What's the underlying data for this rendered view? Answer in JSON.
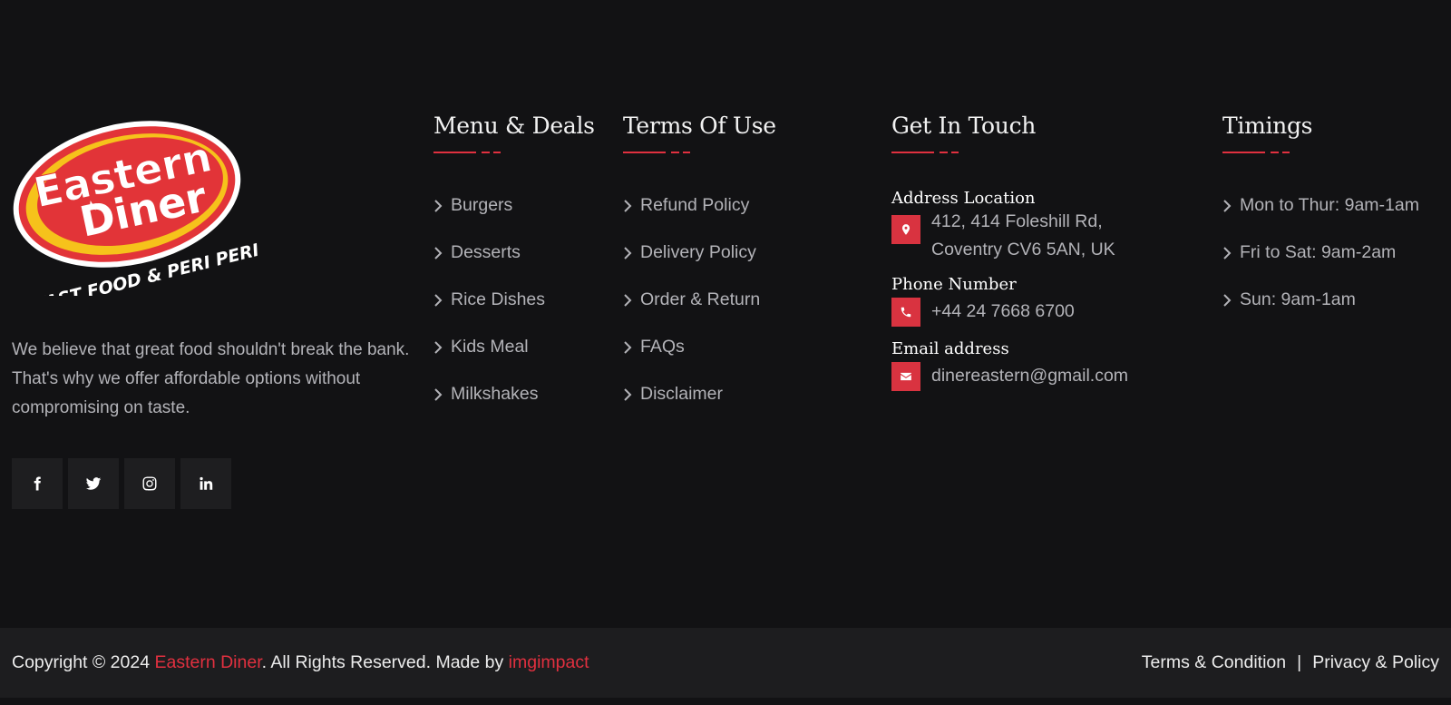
{
  "brand": {
    "logo_line1": "Eastern",
    "logo_line2": "Diner",
    "logo_tagline": "FAST FOOD & PERI PERI",
    "about": "We believe that great food shouldn't break the bank. That's why we offer affordable options without compromising on taste."
  },
  "socials": [
    {
      "icon": "facebook-icon"
    },
    {
      "icon": "twitter-icon"
    },
    {
      "icon": "instagram-icon"
    },
    {
      "icon": "linkedin-icon"
    }
  ],
  "menu": {
    "title": "Menu & Deals",
    "items": [
      "Burgers",
      "Desserts",
      "Rice Dishes",
      "Kids Meal",
      "Milkshakes"
    ]
  },
  "terms": {
    "title": "Terms Of Use",
    "items": [
      "Refund Policy",
      "Delivery Policy",
      "Order & Return",
      "FAQs",
      "Disclaimer"
    ]
  },
  "contact": {
    "title": "Get In Touch",
    "address_label": "Address Location",
    "address_line1": "412, 414 Foleshill Rd,",
    "address_line2": "Coventry CV6 5AN, UK",
    "phone_label": "Phone Number",
    "phone": "+44 24 7668 6700",
    "email_label": "Email address",
    "email": "dinereastern@gmail.com"
  },
  "timings": {
    "title": "Timings",
    "items": [
      "Mon to Thur: 9am-1am",
      "Fri to Sat: 9am-2am",
      "Sun: 9am-1am"
    ]
  },
  "bottom": {
    "copyright_prefix": "Copyright © 2024 ",
    "brand_link": "Eastern Diner",
    "copyright_mid": ". All Rights Reserved. Made by ",
    "maker_link": "imgimpact",
    "terms_link": "Terms & Condition",
    "separator": "|",
    "privacy_link": "Privacy & Policy"
  },
  "colors": {
    "background": "#121214",
    "bottom_bar": "#1d1d1f",
    "accent": "#e0303f",
    "logo_yellow": "#f6c21b"
  }
}
